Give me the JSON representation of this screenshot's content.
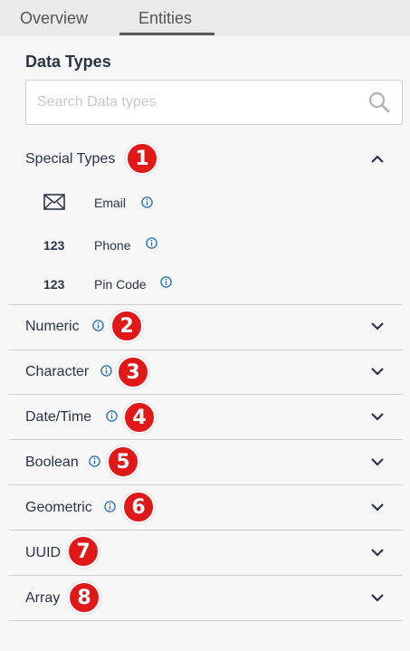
{
  "tabs": {
    "overview": "Overview",
    "entities": "Entities"
  },
  "panel": {
    "title": "Data Types"
  },
  "search": {
    "placeholder": "Search Data types"
  },
  "special_types": {
    "label": "Special Types",
    "badge": "1",
    "items": [
      {
        "icon": "envelope-icon",
        "label": "Email"
      },
      {
        "icon": "number-icon",
        "icon_text": "123",
        "label": "Phone"
      },
      {
        "icon": "number-icon",
        "icon_text": "123",
        "label": "Pin Code"
      }
    ]
  },
  "sections": [
    {
      "label": "Numeric",
      "badge": "2"
    },
    {
      "label": "Character",
      "badge": "3"
    },
    {
      "label": "Date/Time",
      "badge": "4"
    },
    {
      "label": "Boolean",
      "badge": "5"
    },
    {
      "label": "Geometric",
      "badge": "6"
    },
    {
      "label": "UUID",
      "badge": "7"
    },
    {
      "label": "Array",
      "badge": "8"
    }
  ],
  "colors": {
    "badge": "#e01818",
    "info": "#1f6fb2",
    "text": "#2b3346"
  }
}
